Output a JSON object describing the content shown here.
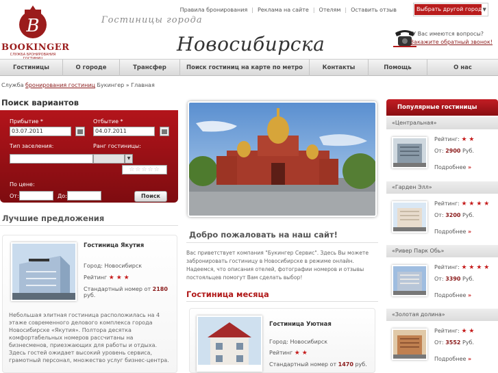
{
  "header": {
    "logo_text": "BOOKINGER",
    "logo_tagline": "СЛУЖБА БРОНИРОВАНИЯ ГОСТИНИЦ",
    "title_small": "Гостиницы города",
    "title_big": "Новосибирска",
    "top_links": [
      "Правила бронирования",
      "Реклама на сайте",
      "Отелям",
      "Оставить отзыв"
    ],
    "city_select": "Выбрать другой город",
    "callback_question": "У Вас имеются вопросы?",
    "callback_link": "Закажите обратный звонок!"
  },
  "nav": [
    "Гостиницы",
    "О городе",
    "Трансфер",
    "Поиск гостиниц на карте по метро",
    "Контакты",
    "Помощь",
    "О нас"
  ],
  "breadcrumb": {
    "prefix": "Служба",
    "link": "бронирования гостиниц",
    "middle": "Букингер »",
    "current": "Главная"
  },
  "search": {
    "title": "Поиск вариантов",
    "arrival_label": "Прибытие *",
    "arrival_value": "03.07.2011",
    "departure_label": "Отбытие *",
    "departure_value": "04.07.2011",
    "room_type_label": "Тип заселения:",
    "rank_label": "Ранг гостиницы:",
    "rank_stars": "☆☆☆☆☆",
    "price_label": "По цене:",
    "from_label": "От:",
    "to_label": "До:",
    "button": "Поиск"
  },
  "best_offers": {
    "title": "Лучшие предложения",
    "hotel_name": "Гостиница Якутия",
    "city": "Город: Новосибирск",
    "rating_label": "Рейтинг",
    "rating": 3,
    "price_label": "Стандартный номер от",
    "price": "2180",
    "currency": "руб.",
    "description": "Небольшая элитная гостиница расположилась на 4 этаже современного делового комплекса города Новосибирске «Якутия». Полтора десятка комфортабельных номеров рассчитаны на бизнесменов, приезжающих для работы и отдыха. Здесь гостей ожидает высокий уровень сервиса, грамотный персонал, множество услуг бизнес-центра."
  },
  "welcome": {
    "title": "Добро пожаловать на наш сайт!",
    "text": "Вас приветствует компания \"Букингер Сервис\". Здесь Вы можете забронировать гостиницу в Новосибирске в режиме онлайн. Надеемся, что описания отелей, фотографии номеров и отзывы постояльцев помогут Вам сделать выбор!"
  },
  "hotel_of_month": {
    "title": "Гостиница месяца",
    "hotel_name": "Гостиница Уютная",
    "city": "Город: Новосибирск",
    "rating_label": "Рейтинг",
    "rating": 2,
    "price_label": "Стандартный номер от",
    "price": "1470",
    "currency": "руб."
  },
  "popular": {
    "title": "Популярные гостиницы",
    "rating_label": "Рейтинг:",
    "from_label": "От:",
    "currency": "Руб.",
    "more": "Подробнее",
    "items": [
      {
        "name": "«Центральная»",
        "rating": 2,
        "price": "2900"
      },
      {
        "name": "«Гарден Элл»",
        "rating": 4,
        "price": "3200"
      },
      {
        "name": "«Ривер Парк Обь»",
        "rating": 4,
        "price": "3390"
      },
      {
        "name": "«Золотая долина»",
        "rating": 2,
        "price": "3552"
      }
    ]
  },
  "colors": {
    "brand_red": "#b01818",
    "accent_dark_red": "#8a1a1a"
  }
}
